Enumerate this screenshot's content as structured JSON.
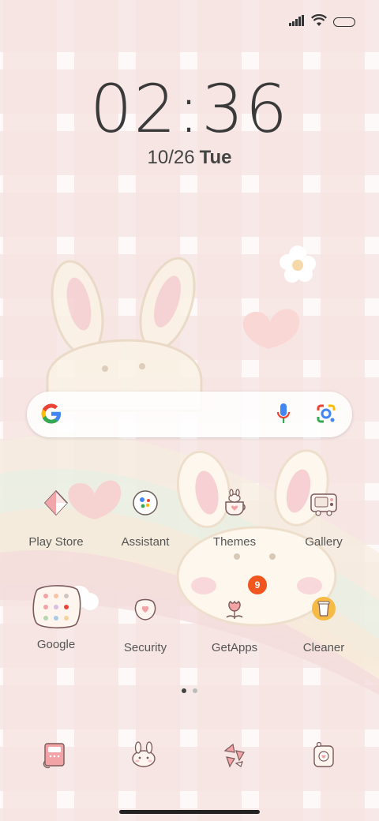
{
  "status_bar": {
    "signal_icon": "signal-icon",
    "wifi_icon": "wifi-icon",
    "battery_icon": "battery-icon"
  },
  "clock": {
    "time": "02:36",
    "date": "10/26",
    "weekday": "Tue"
  },
  "search": {
    "logo": "google-g-icon",
    "mic_icon": "mic-icon",
    "lens_icon": "lens-icon"
  },
  "apps": {
    "row1": [
      {
        "label": "Play Store",
        "icon": "play-store-icon"
      },
      {
        "label": "Assistant",
        "icon": "assistant-icon"
      },
      {
        "label": "Themes",
        "icon": "themes-icon"
      },
      {
        "label": "Gallery",
        "icon": "gallery-icon"
      }
    ],
    "row2": [
      {
        "label": "Google",
        "icon": "google-folder-icon"
      },
      {
        "label": "Security",
        "icon": "security-icon"
      },
      {
        "label": "GetApps",
        "icon": "getapps-icon",
        "badge": "9"
      },
      {
        "label": "Cleaner",
        "icon": "cleaner-icon"
      }
    ]
  },
  "page_indicator": {
    "pages": 2,
    "active": 1
  },
  "dock": [
    "phone-icon",
    "messages-icon",
    "browser-icon",
    "camera-icon"
  ],
  "colors": {
    "accent_pink": "#f3c2c4",
    "badge": "#f0561d",
    "text": "#555555"
  }
}
